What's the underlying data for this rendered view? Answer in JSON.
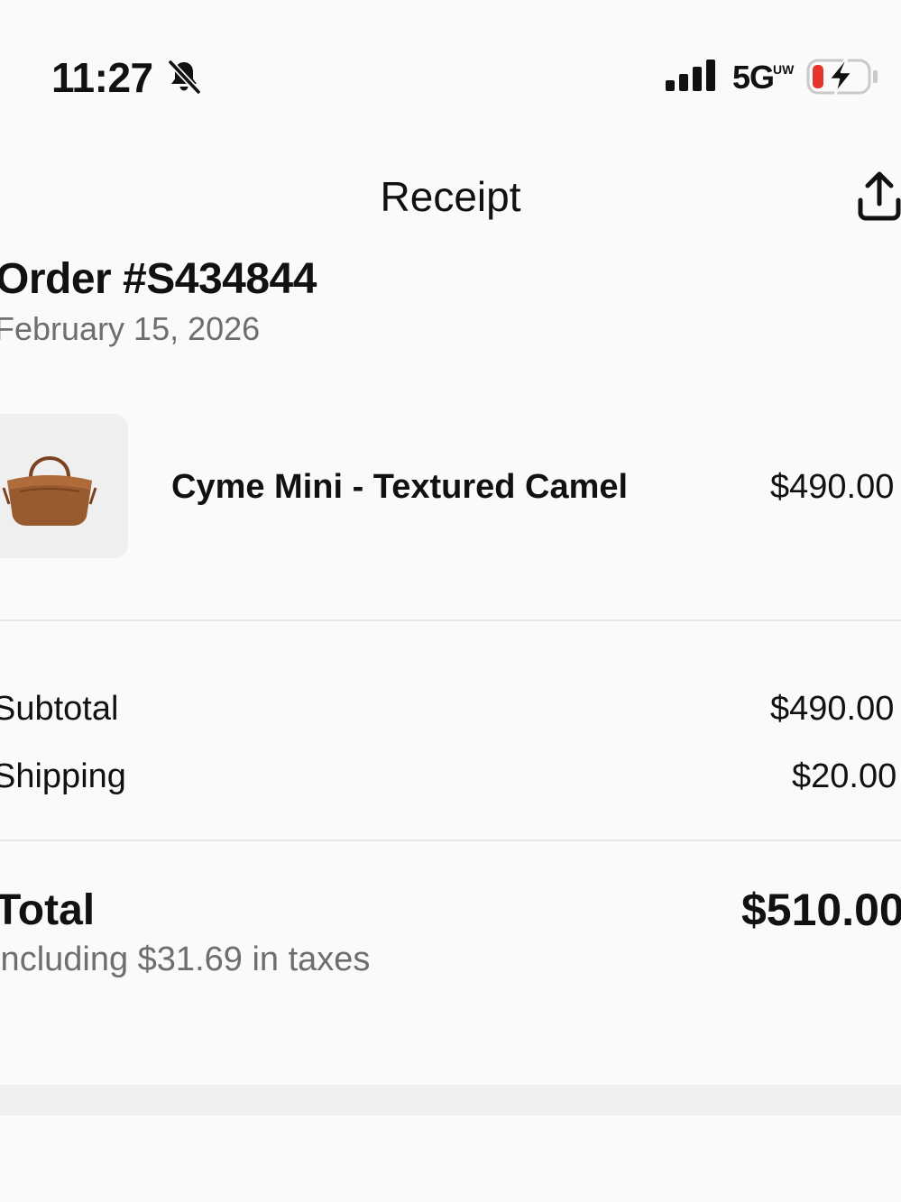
{
  "status_bar": {
    "time": "11:27",
    "network": "5G",
    "network_sub": "UW",
    "bell_icon": "bell-slash-icon",
    "signal_icon": "cellular-signal-icon",
    "battery_icon": "battery-charging-icon",
    "battery_color": "#e5342a"
  },
  "header": {
    "title": "Receipt",
    "share_icon": "share-upload-icon"
  },
  "order": {
    "number": "Order #S434844",
    "date": "February 15, 2026"
  },
  "line_items": [
    {
      "name": "Cyme Mini - Textured Camel",
      "price": "$490.00",
      "image_icon": "camel-handbag-image",
      "image_color": "#9a5a30"
    }
  ],
  "summary": {
    "subtotal_label": "Subtotal",
    "subtotal_value": "$490.00",
    "shipping_label": "Shipping",
    "shipping_value": "$20.00"
  },
  "total": {
    "label": "Total",
    "value": "$510.00",
    "tax_note": "Including $31.69 in taxes"
  }
}
